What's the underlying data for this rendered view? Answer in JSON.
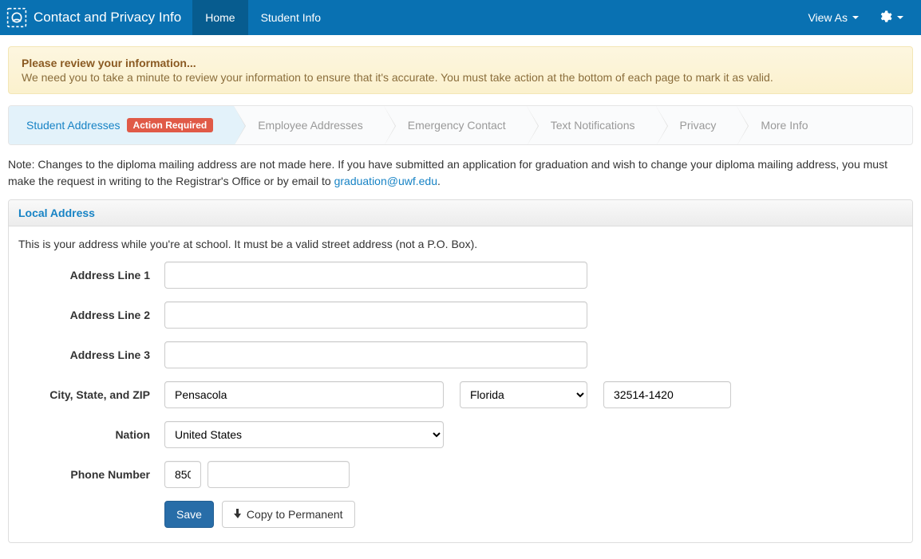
{
  "navbar": {
    "title": "Contact and Privacy Info",
    "items": [
      {
        "label": "Home",
        "active": true
      },
      {
        "label": "Student Info",
        "active": false
      }
    ],
    "viewAs": "View As"
  },
  "alert": {
    "title": "Please review your information...",
    "body": "We need you to take a minute to review your information to ensure that it's accurate. You must take action at the bottom of each page to mark it as valid."
  },
  "steps": [
    {
      "label": "Student Addresses",
      "badge": "Action Required",
      "active": true
    },
    {
      "label": "Employee Addresses"
    },
    {
      "label": "Emergency Contact"
    },
    {
      "label": "Text Notifications"
    },
    {
      "label": "Privacy"
    },
    {
      "label": "More Info"
    }
  ],
  "note": {
    "textBefore": "Note: Changes to the diploma mailing address are not made here. If you have submitted an application for graduation and wish to change your diploma mailing address, you must make the request in writing to the Registrar's Office or by email to ",
    "link": "graduation@uwf.edu",
    "textAfter": "."
  },
  "panel": {
    "heading": "Local Address",
    "description": "This is your address while you're at school. It must be a valid street address (not a P.O. Box).",
    "labels": {
      "line1": "Address Line 1",
      "line2": "Address Line 2",
      "line3": "Address Line 3",
      "cityStateZip": "City, State, and ZIP",
      "nation": "Nation",
      "phone": "Phone Number"
    },
    "values": {
      "line1": "",
      "line2": "",
      "line3": "",
      "city": "Pensacola",
      "state": "Florida",
      "zip": "32514-1420",
      "nation": "United States",
      "phoneArea": "850",
      "phoneNumber": ""
    },
    "buttons": {
      "save": "Save",
      "copy": "Copy to Permanent"
    }
  }
}
